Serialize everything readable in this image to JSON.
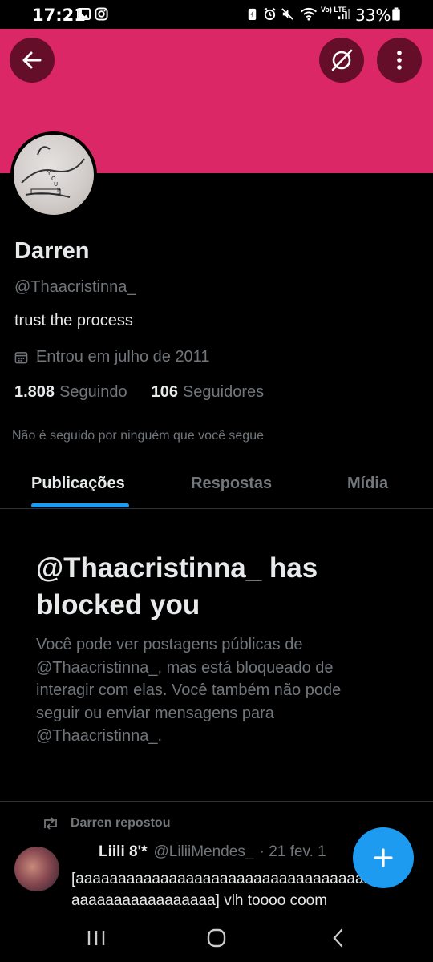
{
  "status_bar": {
    "time": "17:21",
    "network": "Vo) LTE",
    "battery": "33%",
    "icons": [
      "gallery-icon",
      "instagram-icon",
      "battery-saver-icon",
      "alarm-icon",
      "mute-icon",
      "wifi-icon",
      "signal-icon",
      "battery-icon"
    ]
  },
  "header": {
    "banner_color": "#dc2766",
    "back_icon": "arrow-left-icon",
    "grok_icon": "grok-icon",
    "more_icon": "more-vertical-icon"
  },
  "profile": {
    "name": "Darren",
    "handle": "@Thaacristinna_",
    "bio": "trust the process",
    "joined": "Entrou em julho de 2011",
    "following_count": "1.808",
    "following_label": "Seguindo",
    "followers_count": "106",
    "followers_label": "Seguidores",
    "followed_by": "Não é seguido por ninguém que você segue"
  },
  "tabs": [
    {
      "label": "Publicações",
      "active": true
    },
    {
      "label": "Respostas",
      "active": false
    },
    {
      "label": "Mídia",
      "active": false
    }
  ],
  "blocked": {
    "title": "@Thaacristinna_ has blocked you",
    "body": "Você pode ver postagens públicas de @Thaacristinna_, mas está bloqueado de interagir com elas. Você também não pode seguir ou enviar mensagens para @Thaacristinna_."
  },
  "repost": {
    "label": "Darren repostou",
    "author_name": "Liili 8'*",
    "author_handle": "@LiliiMendes_",
    "date": "· 21 fev. 1",
    "text_line1": "[aaaaaaaaaaaaaaaaaaaaaaaaaaaaaaaaaaa",
    "text_line2": "aaaaaaaaaaaaaaaaa] vlh toooo coom"
  },
  "fab_icon": "plus-icon",
  "colors": {
    "accent": "#1d9bf0",
    "muted_text": "#71767b",
    "primary_text": "#e7e9ea"
  }
}
